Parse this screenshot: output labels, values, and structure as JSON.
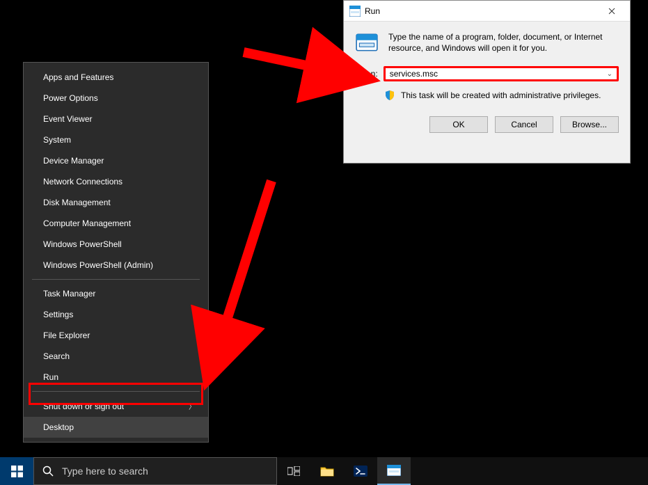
{
  "winx": {
    "items": [
      {
        "label": "Apps and Features",
        "arrow": false
      },
      {
        "label": "Power Options",
        "arrow": false
      },
      {
        "label": "Event Viewer",
        "arrow": false
      },
      {
        "label": "System",
        "arrow": false
      },
      {
        "label": "Device Manager",
        "arrow": false
      },
      {
        "label": "Network Connections",
        "arrow": false
      },
      {
        "label": "Disk Management",
        "arrow": false
      },
      {
        "label": "Computer Management",
        "arrow": false
      },
      {
        "label": "Windows PowerShell",
        "arrow": false
      },
      {
        "label": "Windows PowerShell (Admin)",
        "arrow": false
      }
    ],
    "items2": [
      {
        "label": "Task Manager",
        "arrow": false
      },
      {
        "label": "Settings",
        "arrow": false
      },
      {
        "label": "File Explorer",
        "arrow": false
      },
      {
        "label": "Search",
        "arrow": false
      },
      {
        "label": "Run",
        "arrow": false
      }
    ],
    "items3": [
      {
        "label": "Shut down or sign out",
        "arrow": true
      },
      {
        "label": "Desktop",
        "arrow": false
      }
    ]
  },
  "taskbar": {
    "search_placeholder": "Type here to search"
  },
  "run": {
    "title": "Run",
    "help": "Type the name of a program, folder, document, or Internet resource, and Windows will open it for you.",
    "open_label": "Open:",
    "value": "services.msc",
    "admin_note": "This task will be created with administrative privileges.",
    "ok": "OK",
    "cancel": "Cancel",
    "browse": "Browse..."
  }
}
